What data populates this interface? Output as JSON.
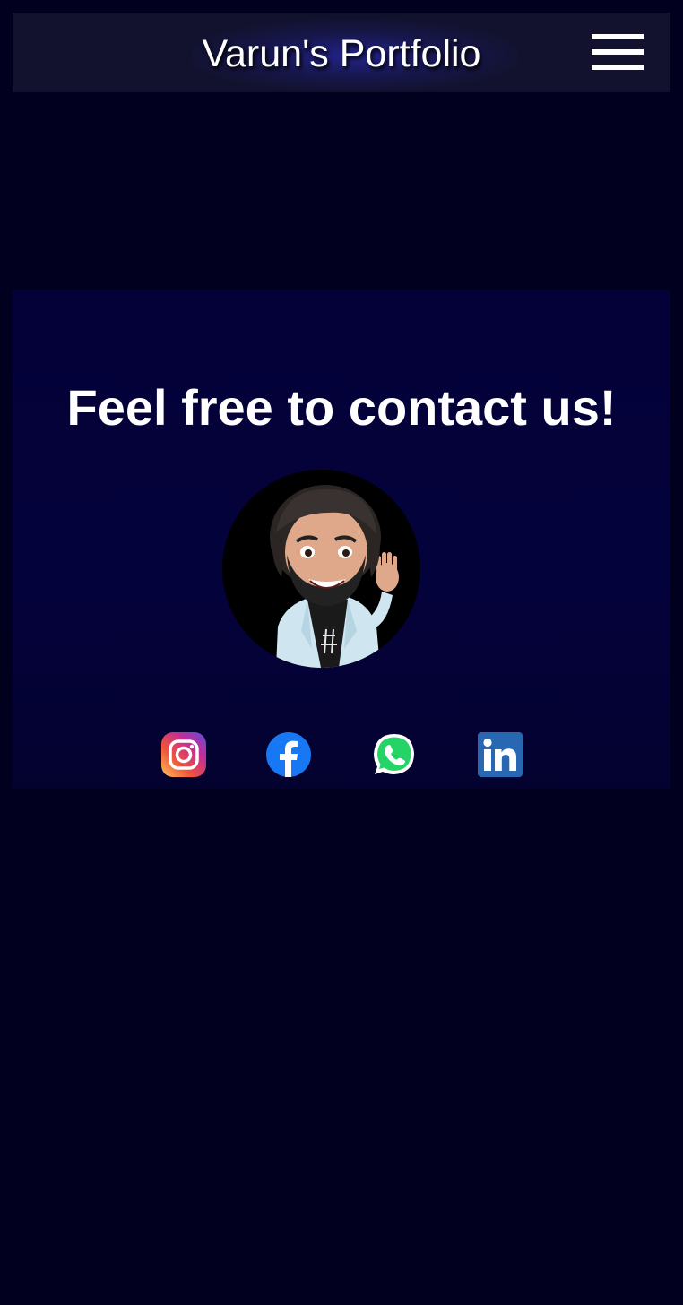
{
  "header": {
    "title": "Varun's Portfolio",
    "menu_icon": "hamburger-menu-icon"
  },
  "contact": {
    "heading": "Feel free to contact us!",
    "avatar_icon": "avatar-memoji-waving"
  },
  "social_links": [
    {
      "name": "instagram",
      "icon": "instagram-icon"
    },
    {
      "name": "facebook",
      "icon": "facebook-icon"
    },
    {
      "name": "whatsapp",
      "icon": "whatsapp-icon"
    },
    {
      "name": "linkedin",
      "icon": "linkedin-icon"
    }
  ],
  "colors": {
    "page_background": "#01001f",
    "header_background": "#12122f",
    "contact_background": "#04023a",
    "text": "#ffffff",
    "instagram": "#e4405f",
    "facebook": "#1877f2",
    "whatsapp": "#25d366",
    "linkedin": "#2867b2"
  }
}
